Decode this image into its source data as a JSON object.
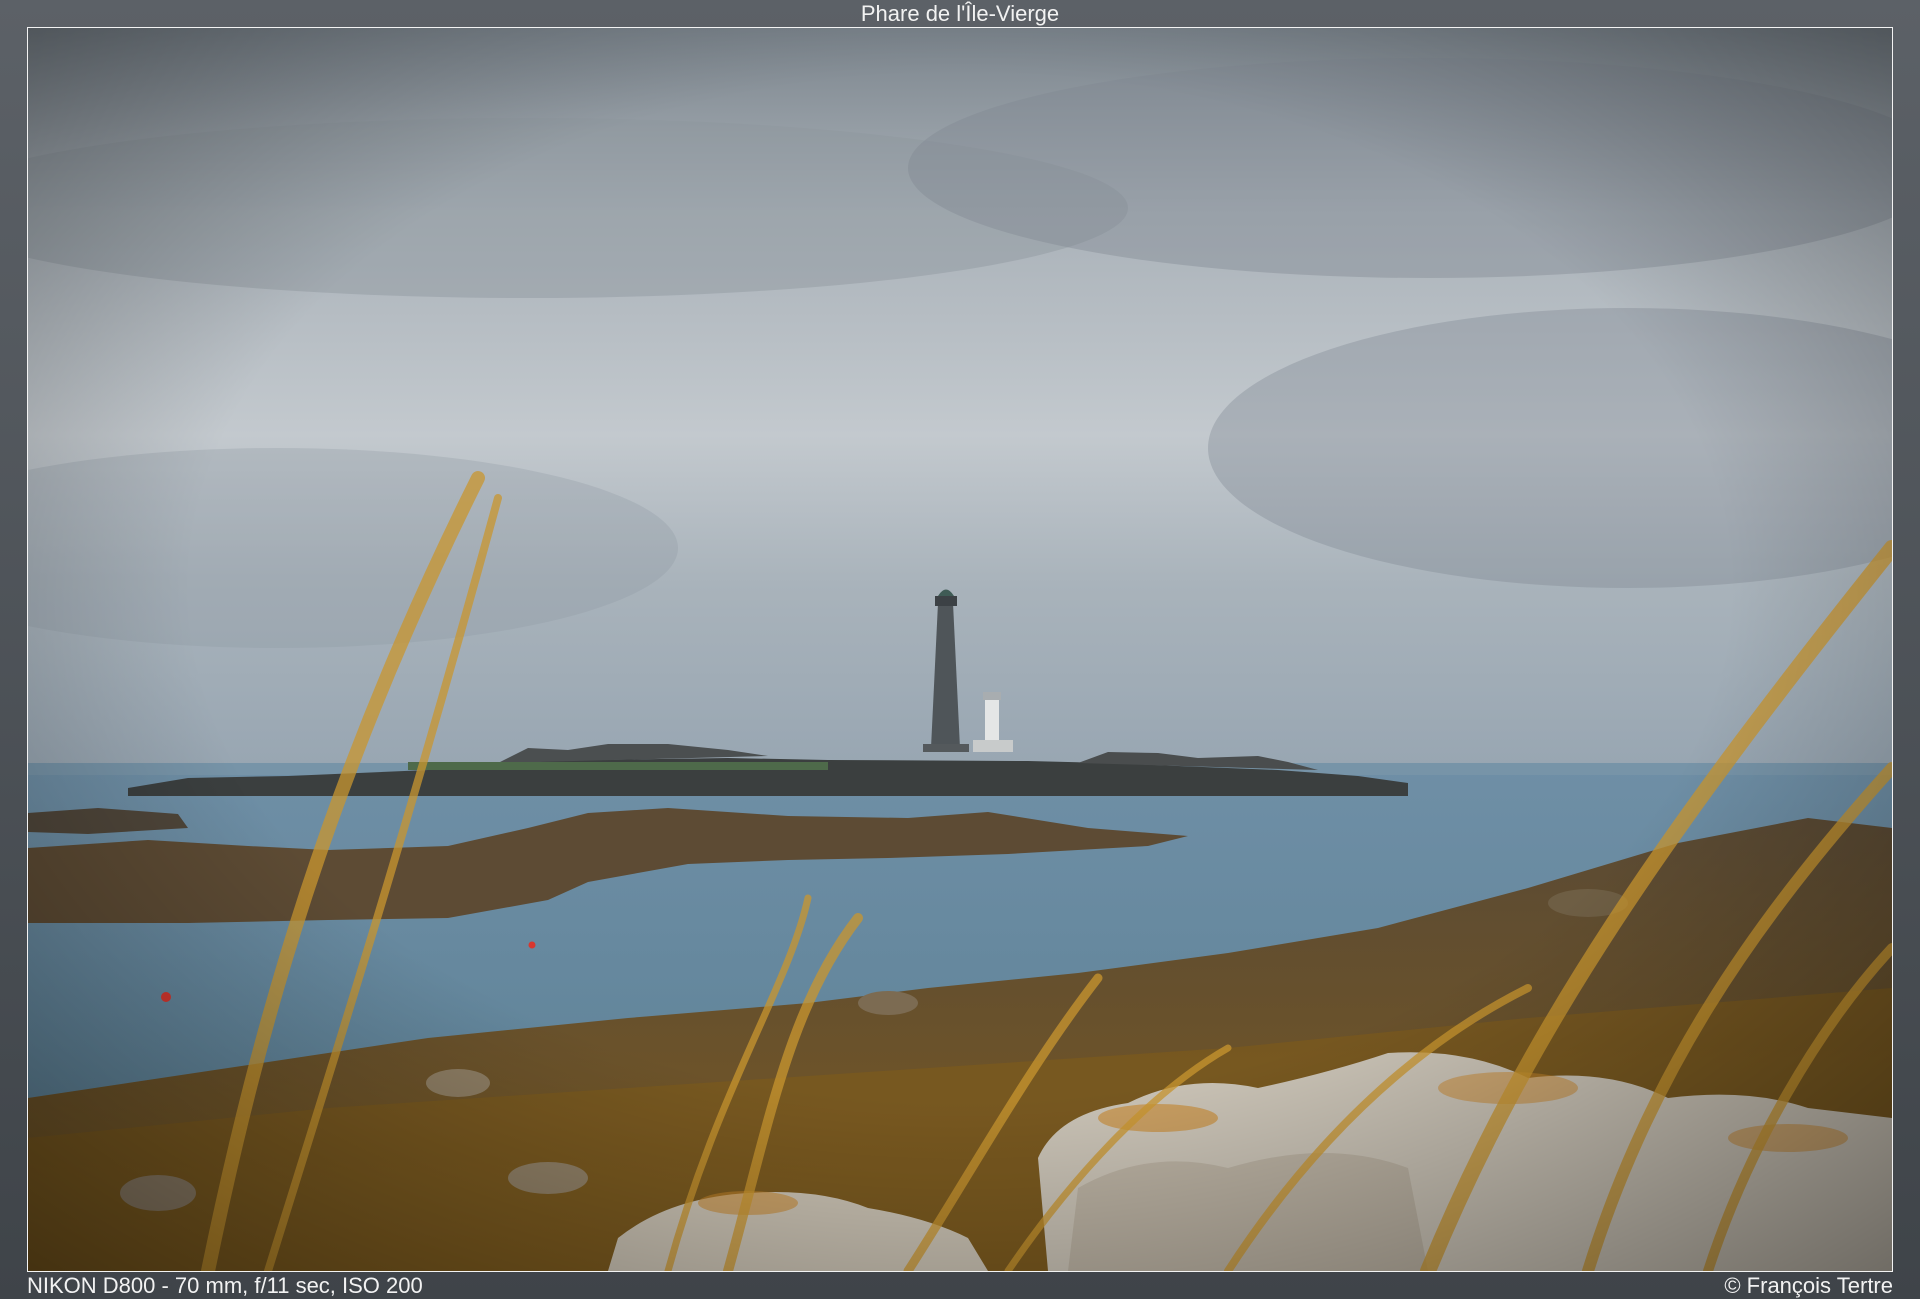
{
  "title": "Phare de l'Île-Vierge",
  "exif": "NIKON D800 - 70 mm, f/11 sec, ISO 200",
  "copyright": "© François Tertre",
  "photo": {
    "description_icon": "landscape-photo",
    "colors": {
      "sky_top": "#6e7880",
      "sky_mid": "#b8c0c6",
      "sea": "#5d7f95",
      "seaweed": "#6b4f28",
      "grass": "#c9962f",
      "rock": "#c9c3b8"
    }
  }
}
